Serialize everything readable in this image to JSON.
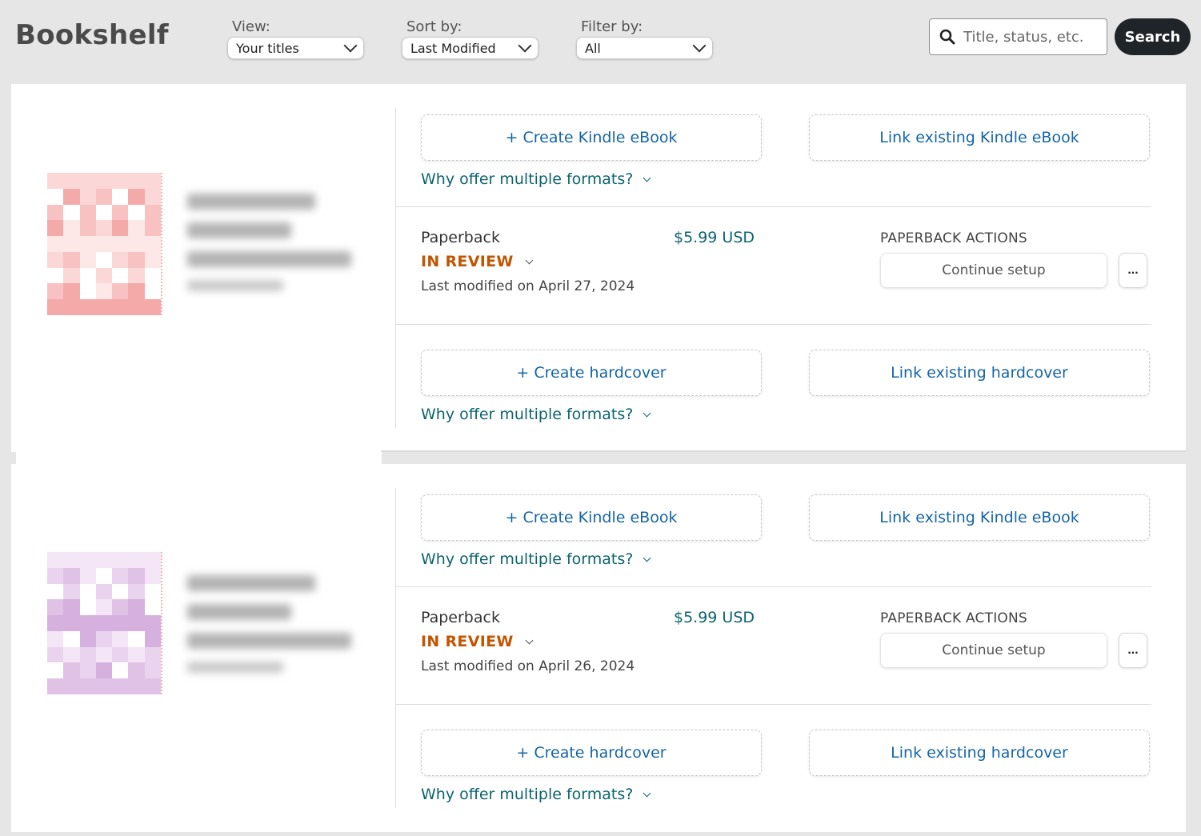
{
  "header": {
    "title": "Bookshelf",
    "view": {
      "label": "View:",
      "selected": "Your titles"
    },
    "sort": {
      "label": "Sort by:",
      "selected": "Last Modified"
    },
    "filter": {
      "label": "Filter by:",
      "selected": "All"
    },
    "search": {
      "placeholder": "Title, status, etc.",
      "button_label": "Search"
    }
  },
  "books": [
    {
      "cover_palette": [
        "#fbd7d7",
        "#f9c2c2",
        "#fde7e7",
        "#ffffff",
        "#f5aaaa"
      ],
      "create_ebook_label": "+ Create Kindle eBook",
      "link_ebook_label": "Link existing Kindle eBook",
      "why_label_1": "Why offer multiple formats?",
      "format_name": "Paperback",
      "status": "IN REVIEW",
      "modified": "Last modified on April 27, 2024",
      "price": "$5.99 USD",
      "actions_label": "PAPERBACK ACTIONS",
      "continue_label": "Continue setup",
      "more_label": "...",
      "create_hardcover_label": "+ Create hardcover",
      "link_hardcover_label": "Link existing hardcover",
      "why_label_2": "Why offer multiple formats?"
    },
    {
      "cover_palette": [
        "#ead3ee",
        "#e0c2e6",
        "#f4e6f6",
        "#ffffff",
        "#d6b0de"
      ],
      "create_ebook_label": "+ Create Kindle eBook",
      "link_ebook_label": "Link existing Kindle eBook",
      "why_label_1": "Why offer multiple formats?",
      "format_name": "Paperback",
      "status": "IN REVIEW",
      "modified": "Last modified on April 26, 2024",
      "price": "$5.99 USD",
      "actions_label": "PAPERBACK ACTIONS",
      "continue_label": "Continue setup",
      "more_label": "...",
      "create_hardcover_label": "+ Create hardcover",
      "link_hardcover_label": "Link existing hardcover",
      "why_label_2": "Why offer multiple formats?"
    }
  ]
}
